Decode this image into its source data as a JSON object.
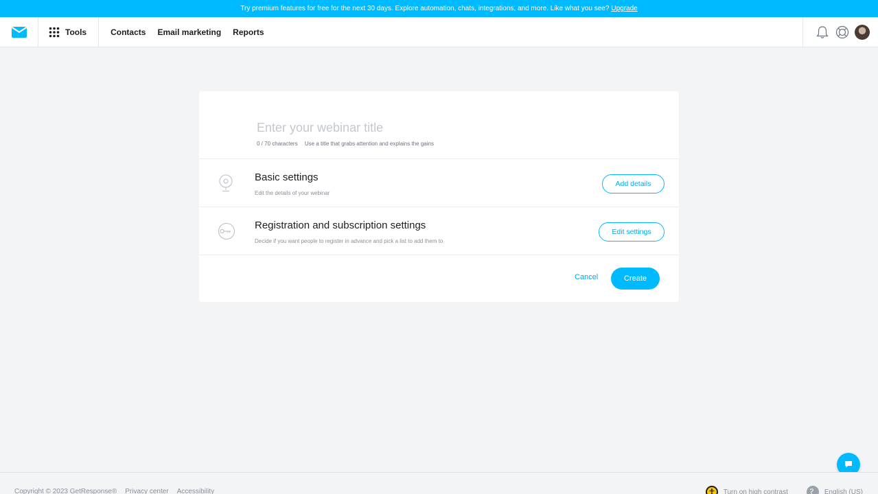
{
  "promo": {
    "text": "Try premium features for free for the next 30 days. Explore automation, chats, integrations, and more. Like what you see?",
    "link": "Upgrade"
  },
  "nav": {
    "tools": "Tools",
    "links": [
      "Contacts",
      "Email marketing",
      "Reports"
    ],
    "icons": [
      "bell-icon",
      "help-icon",
      "avatar"
    ]
  },
  "form": {
    "title_placeholder": "Enter your webinar title",
    "title_value": "",
    "counter": "0 / 70 characters",
    "hint": "Use a title that grabs attention and explains the gains",
    "sections": [
      {
        "title": "Basic settings",
        "desc": "Edit the details of your webinar",
        "button": "Add details",
        "icon": "webcam-icon"
      },
      {
        "title": "Registration and subscription settings",
        "desc": "Decide if you want people to register in advance and pick a list to add them to",
        "button": "Edit settings",
        "icon": "key-icon"
      }
    ],
    "cancel": "Cancel",
    "create": "Create"
  },
  "footer": {
    "copyright": "Copyright © 2023 GetResponse®",
    "privacy": "Privacy center",
    "accessibility": "Accessibility",
    "contrast": "Turn on high contrast",
    "language": "English (US)"
  },
  "colors": {
    "accent": "#00baff",
    "background": "#f3f4f6"
  }
}
